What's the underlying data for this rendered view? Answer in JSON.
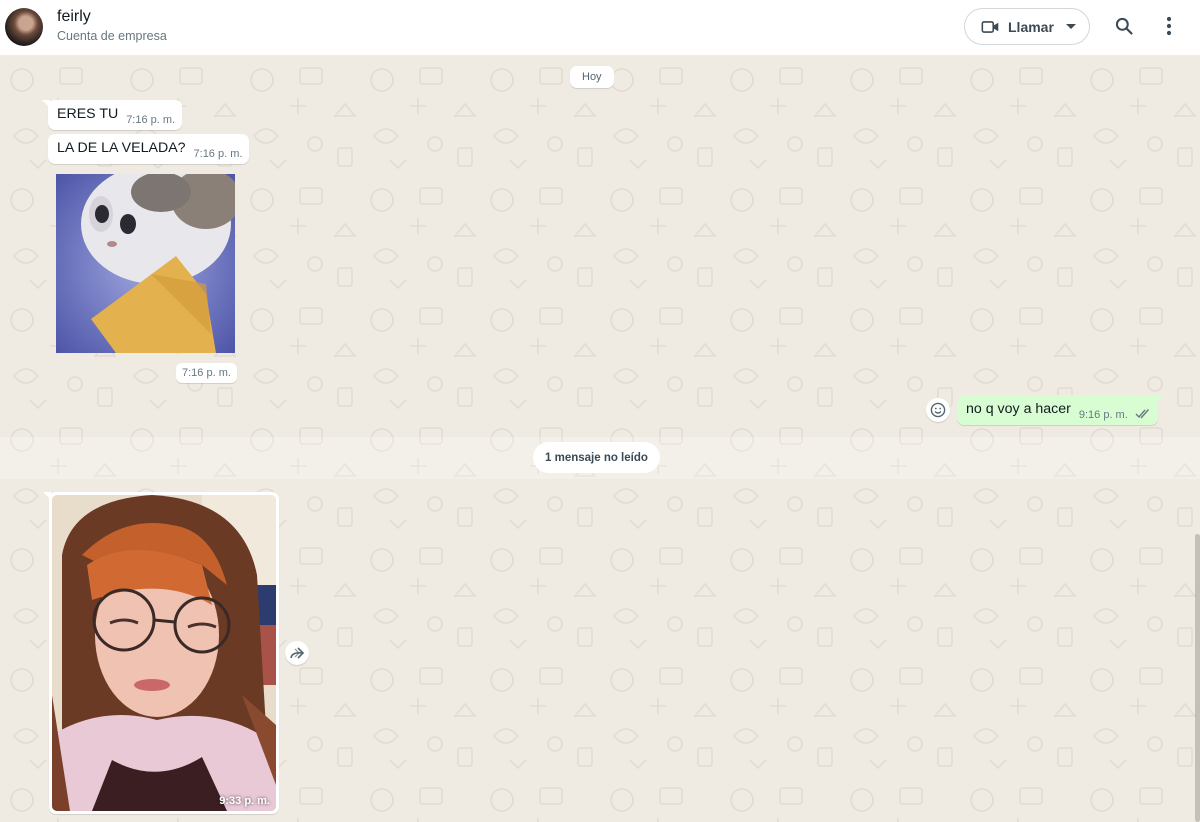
{
  "header": {
    "contact_name": "feirly",
    "contact_subtitle": "Cuenta de empresa",
    "call_label": "Llamar",
    "icons": [
      "video-camera-icon",
      "chevron-down-icon",
      "search-icon",
      "more-vert-icon"
    ]
  },
  "chat": {
    "date_chip": "Hoy",
    "messages": [
      {
        "direction": "in",
        "text": "ERES TU",
        "time": "7:16 p. m."
      },
      {
        "direction": "in",
        "text": "LA DE LA VELADA?",
        "time": "7:16 p. m."
      },
      {
        "direction": "in",
        "type": "sticker",
        "time": "7:16 p. m."
      },
      {
        "direction": "out",
        "text": "no q voy a hacer",
        "time": "9:16 p. m.",
        "status": "read"
      },
      {
        "direction": "in",
        "type": "photo",
        "time": "9:33 p. m."
      }
    ],
    "unread_label": "1 mensaje no leído"
  },
  "colors": {
    "chat_background": "#efeae2",
    "incoming_bubble": "#ffffff",
    "outgoing_bubble": "#d9fdd3",
    "read_ticks": "#667781"
  }
}
